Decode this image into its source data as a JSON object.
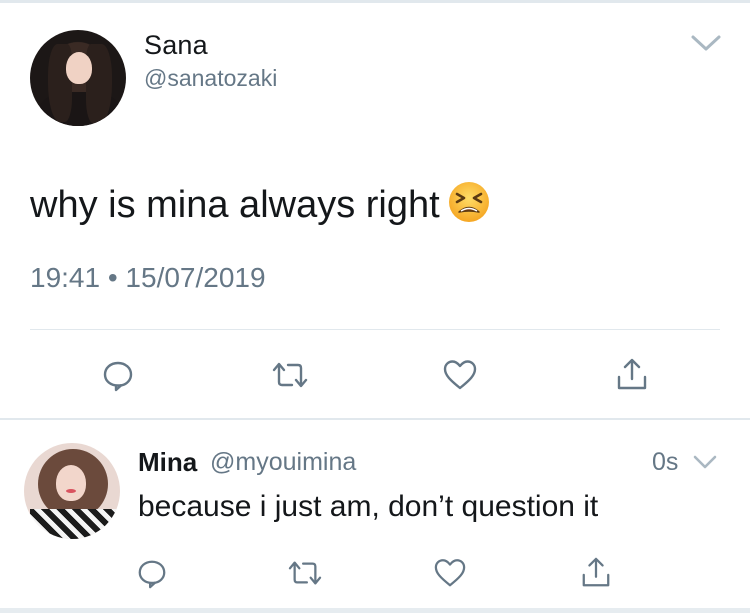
{
  "main_tweet": {
    "display_name": "Sana",
    "handle": "@sanatozaki",
    "text": "why is mina always right",
    "emoji": "tired-face-emoji",
    "timestamp": "19:41 • 15/07/2019",
    "actions": [
      "reply-icon",
      "retweet-icon",
      "like-icon",
      "share-icon"
    ]
  },
  "reply_tweet": {
    "display_name": "Mina",
    "handle": "@myouimina",
    "time": "0s",
    "text": "because i just am, don’t question it",
    "actions": [
      "reply-icon",
      "retweet-icon",
      "like-icon",
      "share-icon"
    ]
  },
  "colors": {
    "text_primary": "#14171a",
    "text_secondary": "#657786",
    "icon": "#657786",
    "divider": "#e1e8ed"
  }
}
